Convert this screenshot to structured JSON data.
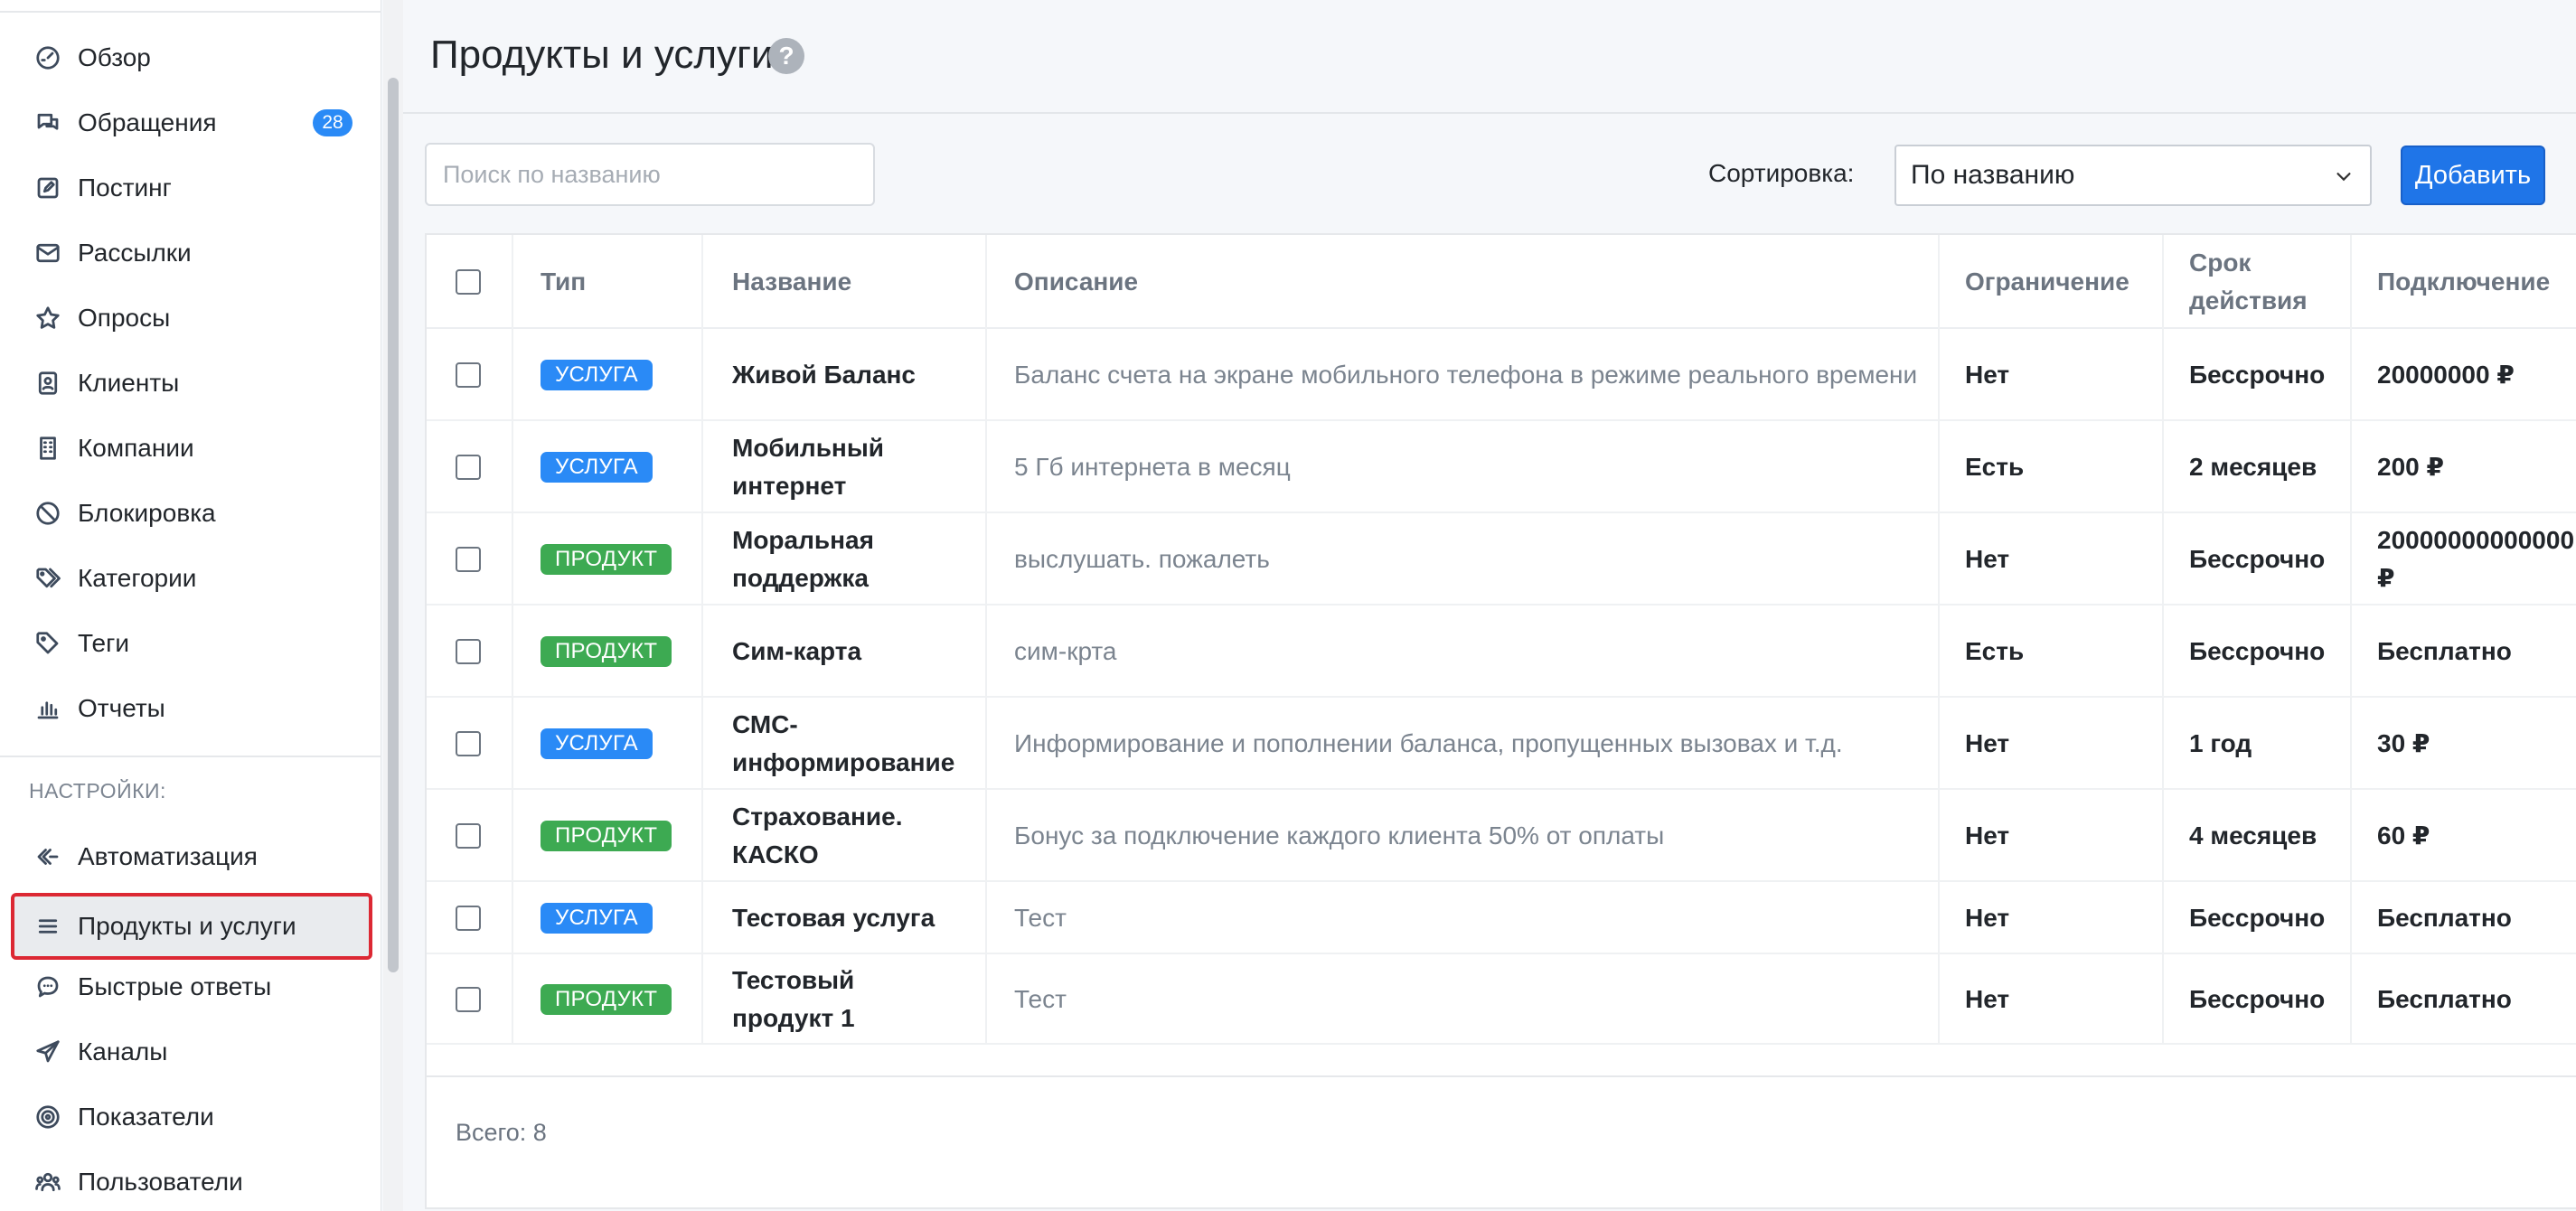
{
  "sidebar": {
    "items": [
      {
        "label": "Обзор",
        "icon": "dashboard-icon"
      },
      {
        "label": "Обращения",
        "icon": "chat-icon",
        "badge": "28"
      },
      {
        "label": "Постинг",
        "icon": "edit-icon"
      },
      {
        "label": "Рассылки",
        "icon": "envelope-icon"
      },
      {
        "label": "Опросы",
        "icon": "star-icon"
      },
      {
        "label": "Клиенты",
        "icon": "contact-book-icon"
      },
      {
        "label": "Компании",
        "icon": "building-icon"
      },
      {
        "label": "Блокировка",
        "icon": "ban-icon"
      },
      {
        "label": "Категории",
        "icon": "tags-icon"
      },
      {
        "label": "Теги",
        "icon": "tag-icon"
      },
      {
        "label": "Отчеты",
        "icon": "bar-chart-icon"
      }
    ],
    "settings_label": "НАСТРОЙКИ:",
    "settings_items": [
      {
        "label": "Автоматизация",
        "icon": "automation-icon"
      },
      {
        "label": "Продукты и услуги",
        "icon": "list-icon",
        "active": true
      },
      {
        "label": "Быстрые ответы",
        "icon": "quick-reply-icon"
      },
      {
        "label": "Каналы",
        "icon": "paper-plane-icon"
      },
      {
        "label": "Показатели",
        "icon": "target-icon"
      },
      {
        "label": "Пользователи",
        "icon": "users-icon"
      }
    ]
  },
  "header": {
    "title": "Продукты и услуги",
    "help_icon": "?"
  },
  "toolbar": {
    "search_placeholder": "Поиск по названию",
    "sort_label": "Сортировка:",
    "sort_value": "По названию",
    "add_label": "Добавить"
  },
  "table": {
    "columns": {
      "type": "Тип",
      "name": "Название",
      "description": "Описание",
      "limit": "Ограничение",
      "term": "Срок действия",
      "connection": "Подключение"
    },
    "rows": [
      {
        "type": "УСЛУГА",
        "kind": "service",
        "name": "Живой Баланс",
        "description": "Баланс счета на экране мобильного телефона в режиме реального времени",
        "limit": "Нет",
        "term": "Бессрочно",
        "connection": "20000000 ₽"
      },
      {
        "type": "УСЛУГА",
        "kind": "service",
        "name": "Мобильный интернет",
        "description": "5 Гб интернета в месяц",
        "limit": "Есть",
        "term": "2 месяцев",
        "connection": "200 ₽"
      },
      {
        "type": "ПРОДУКТ",
        "kind": "product",
        "name": "Моральная поддержка",
        "description": "выслушать. пожалеть",
        "limit": "Нет",
        "term": "Бессрочно",
        "connection": "20000000000000 ₽"
      },
      {
        "type": "ПРОДУКТ",
        "kind": "product",
        "name": "Сим-карта",
        "description": "сим-крта",
        "limit": "Есть",
        "term": "Бессрочно",
        "connection": "Бесплатно"
      },
      {
        "type": "УСЛУГА",
        "kind": "service",
        "name": "СМС-информирование",
        "description": "Информирование и пополнении баланса, пропущенных вызовах и т.д.",
        "limit": "Нет",
        "term": "1 год",
        "connection": "30 ₽"
      },
      {
        "type": "ПРОДУКТ",
        "kind": "product",
        "name": "Страхование. КАСКО",
        "description": "Бонус за подключение каждого клиента 50% от оплаты",
        "limit": "Нет",
        "term": "4 месяцев",
        "connection": "60 ₽"
      },
      {
        "type": "УСЛУГА",
        "kind": "service",
        "name": "Тестовая услуга",
        "description": "Тест",
        "limit": "Нет",
        "term": "Бессрочно",
        "connection": "Бесплатно"
      },
      {
        "type": "ПРОДУКТ",
        "kind": "product",
        "name": "Тестовый продукт 1",
        "description": "Тест",
        "limit": "Нет",
        "term": "Бессрочно",
        "connection": "Бесплатно"
      }
    ],
    "total": "Всего: 8"
  },
  "colors": {
    "accent": "#1f75e8",
    "service_tag": "#2a8af6",
    "product_tag": "#3daa52",
    "active_outline": "#dc2833"
  }
}
